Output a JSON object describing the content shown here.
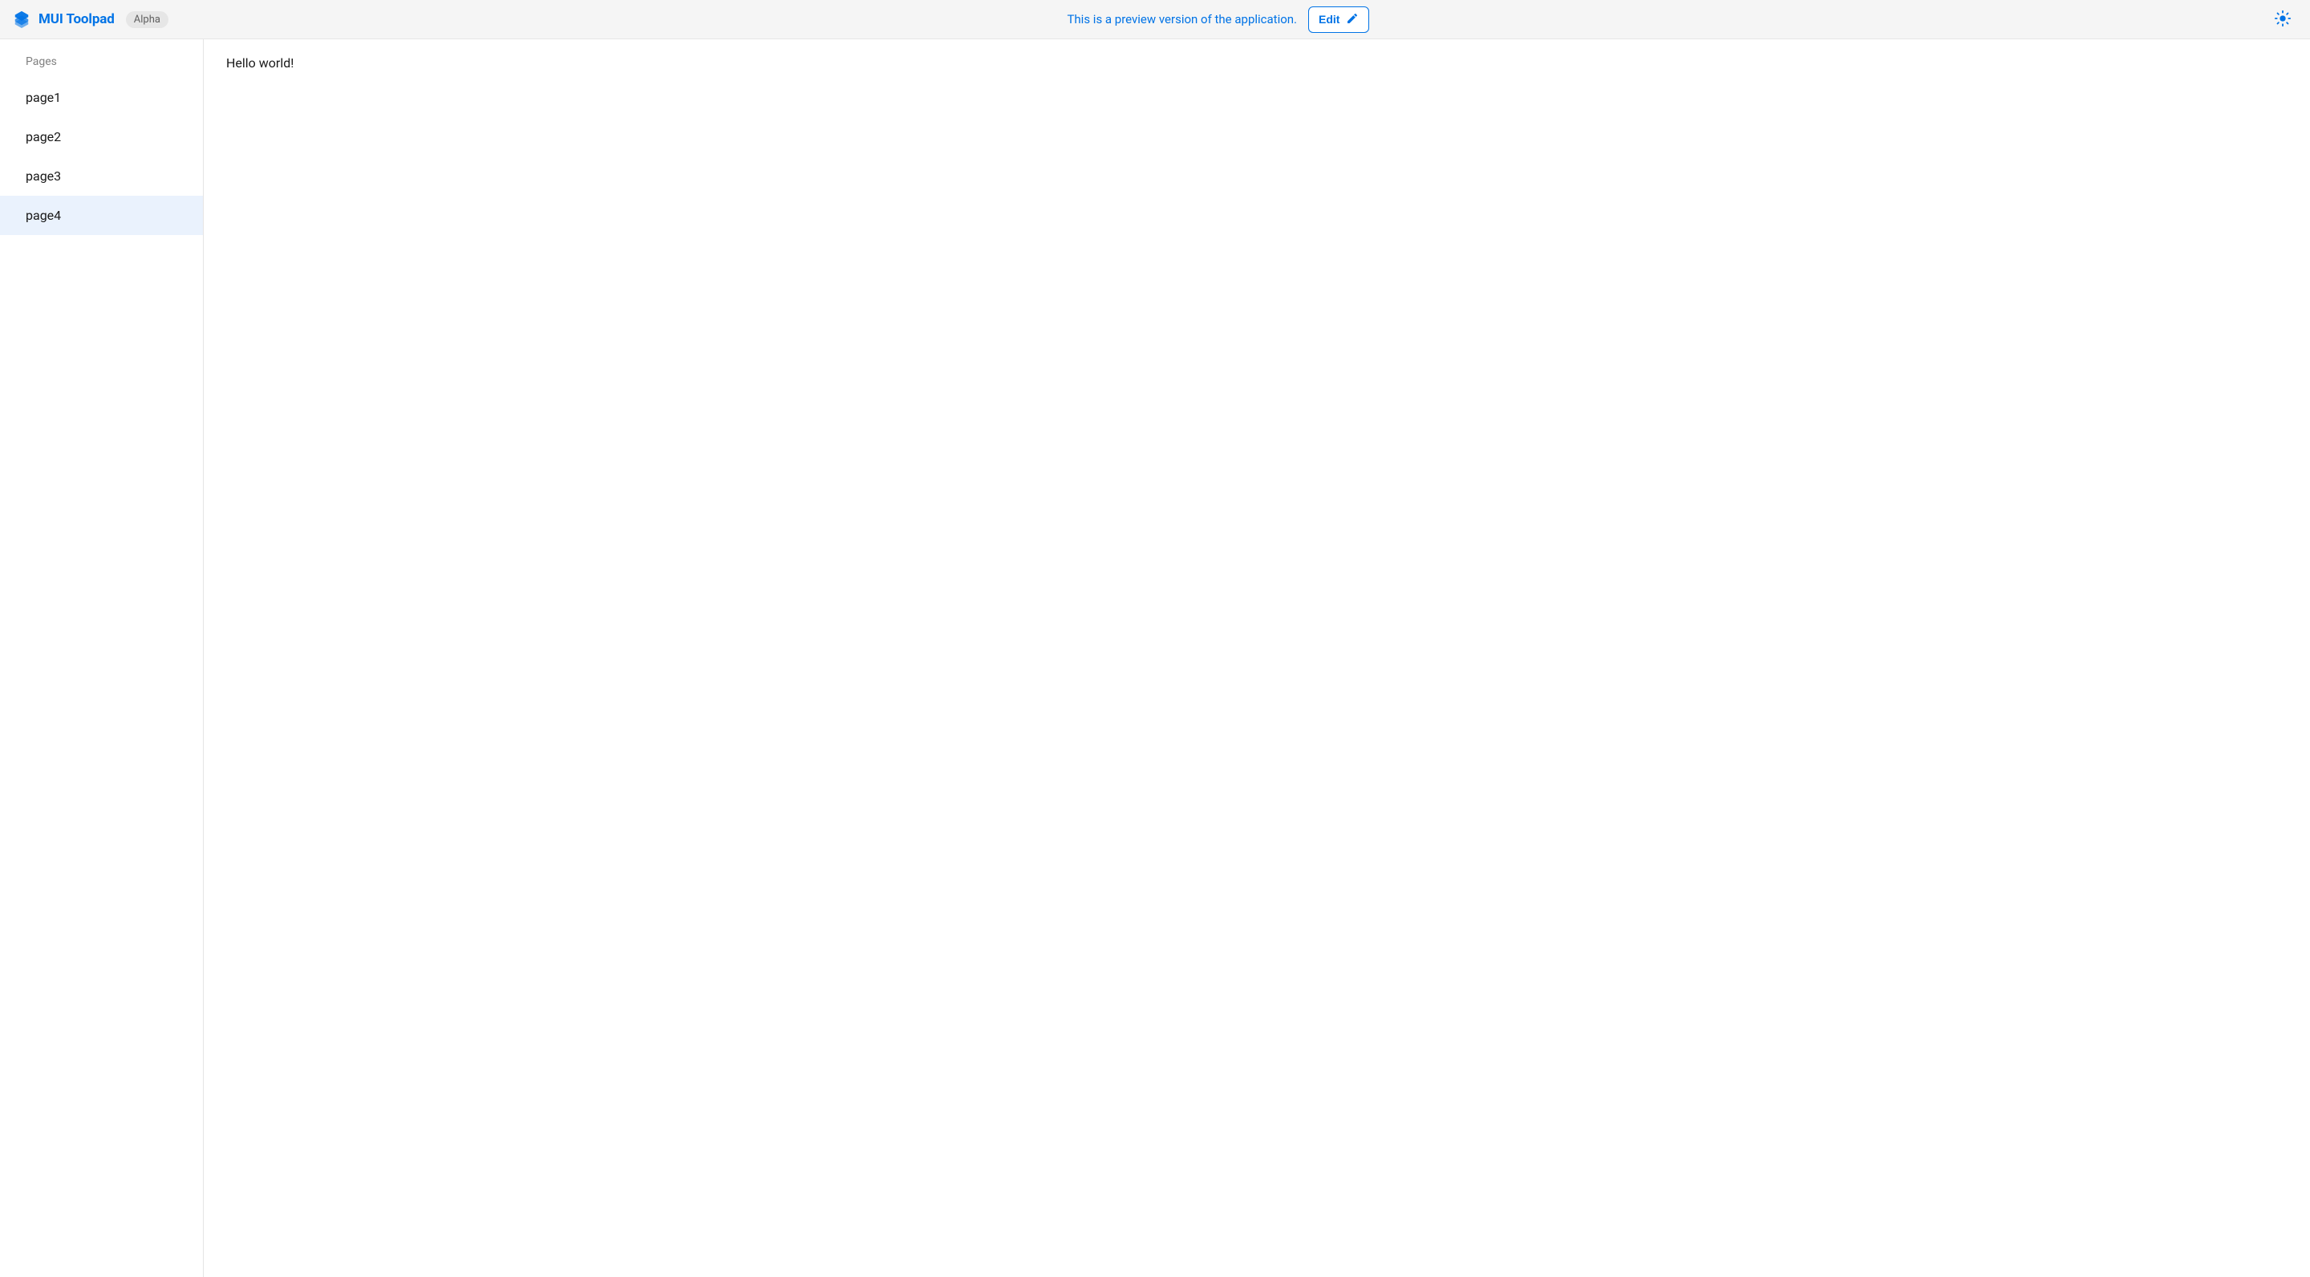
{
  "header": {
    "brand": "MUI Toolpad",
    "chip": "Alpha",
    "preview_text": "This is a preview version of the application.",
    "edit_label": "Edit"
  },
  "sidebar": {
    "section_title": "Pages",
    "items": [
      {
        "label": "page1",
        "active": false
      },
      {
        "label": "page2",
        "active": false
      },
      {
        "label": "page3",
        "active": false
      },
      {
        "label": "page4",
        "active": true
      }
    ]
  },
  "main": {
    "content": "Hello world!"
  }
}
